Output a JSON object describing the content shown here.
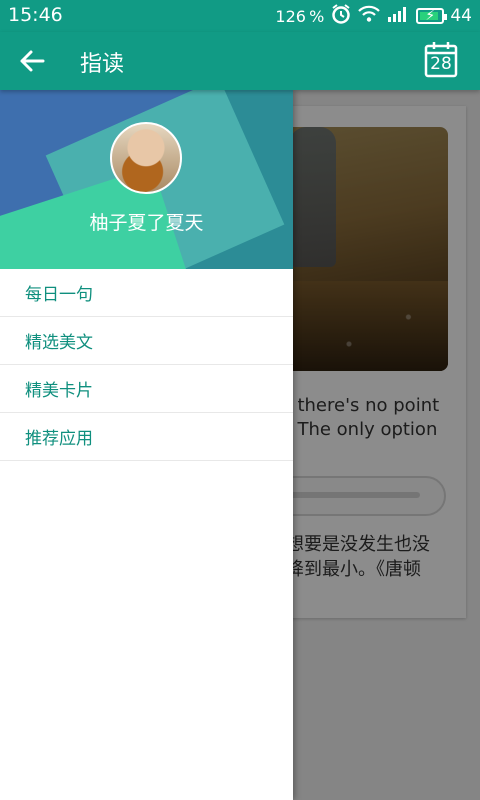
{
  "status_bar": {
    "time": "15:46",
    "network_speed": "126 %",
    "battery_level": "44",
    "icons": [
      "alarm-icon",
      "wifi-icon",
      "signal-icon",
      "battery-icon"
    ]
  },
  "app_bar": {
    "title": "指读",
    "calendar_day": "28",
    "icons": [
      "back-arrow-icon",
      "calendar-icon"
    ]
  },
  "drawer": {
    "username": "柚子夏了夏天",
    "items": [
      {
        "label": "每日一句"
      },
      {
        "label": "精选美文"
      },
      {
        "label": "精美卡片"
      },
      {
        "label": "推荐应用"
      }
    ]
  },
  "background_card": {
    "english_lines": [
      ", there's no point",
      ". The only option"
    ],
    "chinese_lines": [
      "想要是没发生也没",
      "降到最小。《唐顿"
    ]
  },
  "colors": {
    "primary": "#119b85",
    "accent_text": "#0f8f7e"
  }
}
